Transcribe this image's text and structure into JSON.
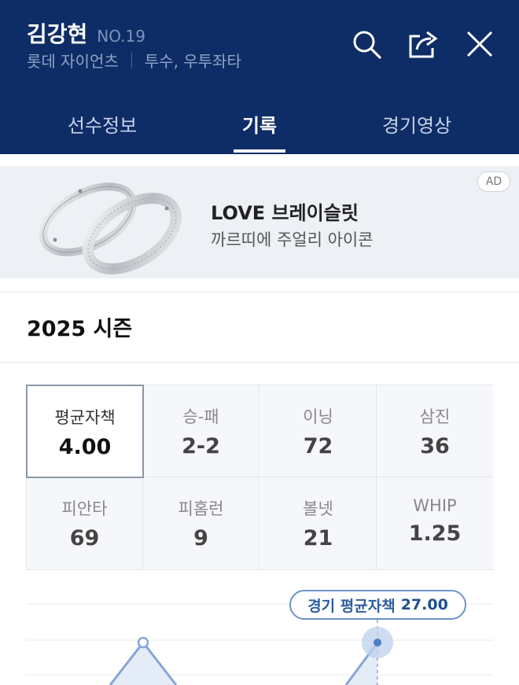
{
  "player": {
    "name": "김강현",
    "number": "NO.19",
    "team": "롯데 자이언츠",
    "position": "투수, 우투좌타"
  },
  "header_icons": [
    "search-icon",
    "share-icon",
    "close-icon"
  ],
  "tabs": [
    {
      "label": "선수정보",
      "active": false
    },
    {
      "label": "기록",
      "active": true
    },
    {
      "label": "경기영상",
      "active": false
    }
  ],
  "ad": {
    "title": "LOVE 브레이슬릿",
    "subtitle": "까르띠에 주얼리 아이콘",
    "badge": "AD"
  },
  "season": {
    "title": "2025 시즌"
  },
  "stats": [
    {
      "label": "평균자책",
      "value": "4.00",
      "selected": true
    },
    {
      "label": "승-패",
      "value": "2-2",
      "selected": false
    },
    {
      "label": "이닝",
      "value": "72",
      "selected": false
    },
    {
      "label": "삼진",
      "value": "36",
      "selected": false
    },
    {
      "label": "피안타",
      "value": "69",
      "selected": false
    },
    {
      "label": "피홈런",
      "value": "9",
      "selected": false
    },
    {
      "label": "볼넷",
      "value": "21",
      "selected": false
    },
    {
      "label": "WHIP",
      "value": "1.25",
      "selected": false
    }
  ],
  "chart": {
    "tooltip_label": "경기 평균자책",
    "tooltip_value": "27.00"
  },
  "colors": {
    "header_bg": "#0e2d66",
    "accent": "#2f5d9e",
    "ad_bg": "#edf0f4"
  }
}
